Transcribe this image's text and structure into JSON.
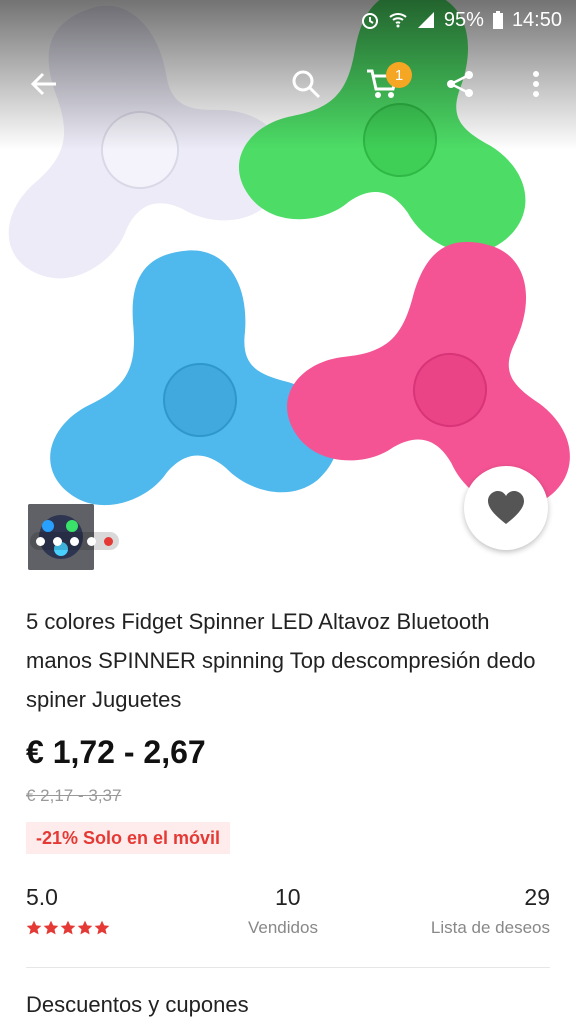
{
  "status_bar": {
    "battery": "95%",
    "time": "14:50",
    "icons": [
      "alarm-icon",
      "wifi-icon",
      "signal-icon",
      "battery-icon"
    ]
  },
  "toolbar": {
    "icons": [
      "back-arrow-icon",
      "search-icon",
      "cart-icon",
      "share-icon",
      "more-vert-icon"
    ],
    "cart_count": "1"
  },
  "product": {
    "image_colors": [
      "#ecebf7",
      "#4ddd66",
      "#4fb8ec",
      "#f55494"
    ],
    "title": "5 colores Fidget Spinner LED Altavoz Bluetooth manos SPINNER spinning Top descompresión dedo spiner Juguetes",
    "price": "€ 1,72 - 2,67",
    "old_price": "€ 2,17 - 3,37",
    "promo": "-21% Solo en el móvil",
    "gallery_dots": 5,
    "gallery_active_index": 4
  },
  "stats": {
    "rating": {
      "value": "5.0",
      "stars": 5
    },
    "sold": {
      "value": "10",
      "label": "Vendidos"
    },
    "wishlist": {
      "value": "29",
      "label": "Lista de deseos"
    }
  },
  "sections": {
    "coupons": "Descuentos y cupones"
  },
  "colors": {
    "accent_red": "#e53935",
    "badge_orange": "#f5a623",
    "promo_bg": "#fdeceb"
  }
}
